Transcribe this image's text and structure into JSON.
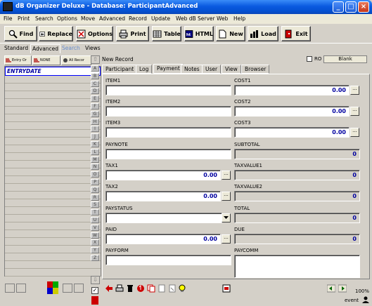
{
  "window": {
    "title": "dB Organizer Deluxe - Database: ParticipantAdvanced"
  },
  "menu": [
    "File",
    "Print",
    "Search",
    "Options",
    "Move",
    "Advanced",
    "Record",
    "Update",
    "Web dB Server",
    "Web",
    "Help"
  ],
  "toolbar": {
    "find": "Find",
    "replace": "Replace",
    "options": "Options",
    "print": "Print",
    "table": "Table",
    "html": "HTML",
    "new": "New",
    "load": "Load",
    "exit": "Exit"
  },
  "mode_tabs": [
    "Standard",
    "Advanced",
    "Search",
    "Views"
  ],
  "left_buttons": {
    "entry_order": "Entry Or",
    "none": "NONE",
    "all_records": "All Recor"
  },
  "left_table": {
    "header": "ENTRYDATE"
  },
  "letters": [
    "A",
    "B",
    "C",
    "D",
    "E",
    "F",
    "G",
    "H",
    "I",
    "J",
    "K",
    "L",
    "M",
    "N",
    "O",
    "P",
    "Q",
    "R",
    "S",
    "T",
    "U",
    "V",
    "W",
    "X",
    "Y",
    "Z"
  ],
  "record": {
    "status": "New Record",
    "ro_label": "RO",
    "blank_button": "Blank"
  },
  "form_tabs": [
    "Participant",
    "Log",
    "Payment",
    "Notes",
    "User",
    "View",
    "Browser"
  ],
  "fields": {
    "item1": {
      "label": "ITEM1",
      "value": ""
    },
    "cost1": {
      "label": "COST1",
      "value": "0.00"
    },
    "item2": {
      "label": "ITEM2",
      "value": ""
    },
    "cost2": {
      "label": "COST2",
      "value": "0.00"
    },
    "item3": {
      "label": "ITEM3",
      "value": ""
    },
    "cost3": {
      "label": "COST3",
      "value": "0.00"
    },
    "paynote": {
      "label": "PAYNOTE",
      "value": ""
    },
    "subtotal": {
      "label": "SUBTOTAL",
      "value": "0"
    },
    "tax1": {
      "label": "TAX1",
      "value": "0.00"
    },
    "taxvalue1": {
      "label": "TAXVALUE1",
      "value": "0"
    },
    "tax2": {
      "label": "TAX2",
      "value": "0.00"
    },
    "taxvalue2": {
      "label": "TAXVALUE2",
      "value": "0"
    },
    "paystatus": {
      "label": "PAYSTATUS",
      "value": ""
    },
    "total": {
      "label": "TOTAL",
      "value": "0"
    },
    "paid": {
      "label": "PAID",
      "value": "0.00"
    },
    "due": {
      "label": "DUE",
      "value": "0"
    },
    "payform": {
      "label": "PAYFORM",
      "value": ""
    },
    "paycomm": {
      "label": "PAYCOMM",
      "value": ""
    }
  },
  "status": {
    "zoom": "100%",
    "mode": "event"
  },
  "dots_label": "..."
}
